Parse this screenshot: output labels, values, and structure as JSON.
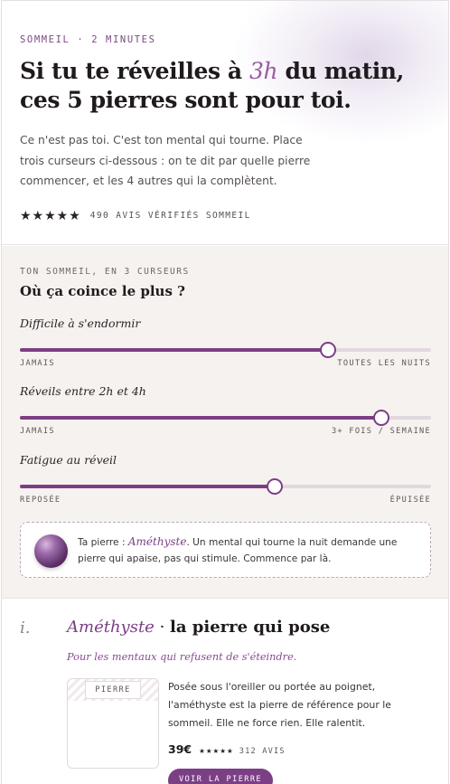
{
  "hero": {
    "kicker": "SOMMEIL · 2 MINUTES",
    "title_before": "Si tu te réveilles à ",
    "title_em": "3h",
    "title_after": " du matin, ces 5 pierres sont pour toi.",
    "lede": "Ce n'est pas toi. C'est ton mental qui tourne. Place trois curseurs ci-dessous : on te dit par quelle pierre commencer, et les 4 autres qui la complètent.",
    "stars": "★★★★★",
    "rating_text": "490 AVIS VÉRIFIÉS SOMMEIL"
  },
  "quiz": {
    "kicker": "TON SOMMEIL, EN 3 CURSEURS",
    "title": "Où ça coince le plus ?",
    "sliders": [
      {
        "label": "Difficile à s'endormir",
        "min_label": "JAMAIS",
        "max_label": "TOUTES LES NUITS",
        "value": 0.75
      },
      {
        "label": "Réveils entre 2h et 4h",
        "min_label": "JAMAIS",
        "max_label": "3+ FOIS / SEMAINE",
        "value": 0.88
      },
      {
        "label": "Fatigue au réveil",
        "min_label": "REPOSÉE",
        "max_label": "ÉPUISÉE",
        "value": 0.62
      }
    ],
    "result": {
      "prefix": "Ta pierre : ",
      "stone": "Améthyste",
      "text": ". Un mental qui tourne la nuit demande une pierre qui apaise, pas qui stimule. Commence par là."
    }
  },
  "product": {
    "numeral": "i.",
    "name": "Améthyste",
    "separator": " · ",
    "title_rest": "la pierre qui pose",
    "subtitle": "Pour les mentaux qui refusent de s'éteindre.",
    "card_tag": "PIERRE",
    "description": "Posée sous l'oreiller ou portée au poignet, l'améthyste est la pierre de référence pour le sommeil. Elle ne force rien. Elle ralentit.",
    "price": "39€",
    "mini_stars": "★★★★★",
    "reviews": "312 AVIS",
    "cta": "VOIR LA PIERRE"
  },
  "colors": {
    "accent": "#7c3f86",
    "quiz_bg": "#f6f2ef",
    "track": "#e1d8de"
  }
}
